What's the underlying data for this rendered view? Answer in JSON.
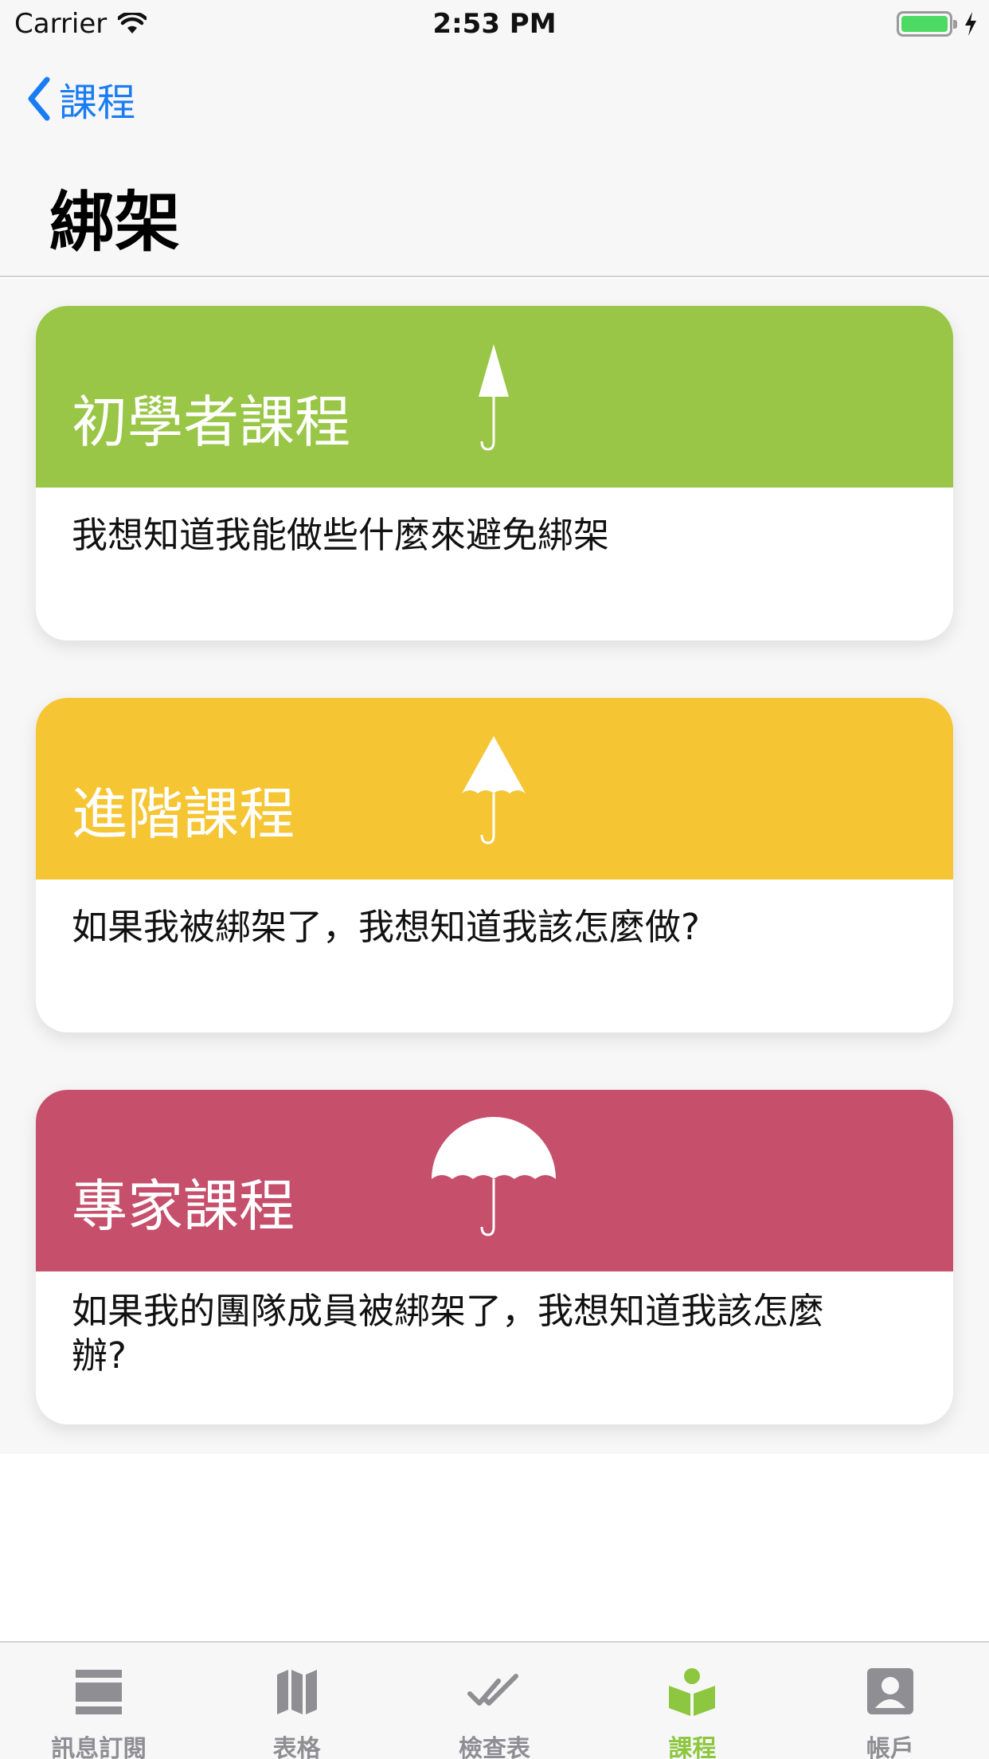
{
  "status_bar": {
    "carrier": "Carrier",
    "time": "2:53 PM"
  },
  "nav": {
    "back_label": "課程",
    "title": "綁架"
  },
  "colors": {
    "beginner": "#99c646",
    "advanced": "#f5c534",
    "expert": "#c64f6c",
    "tab_active": "#8dc63f",
    "tab_inactive": "#8e8e93",
    "link": "#1a7cf3"
  },
  "cards": [
    {
      "title": "初學者課程",
      "description": "我想知道我能做些什麼來避免綁架",
      "icon": "closed-umbrella-icon"
    },
    {
      "title": "進階課程",
      "description": "如果我被綁架了，我想知道我該怎麼做?",
      "icon": "half-open-umbrella-icon"
    },
    {
      "title": "專家課程",
      "description": "如果我的團隊成員被綁架了，我想知道我該怎麼辦?",
      "icon": "open-umbrella-icon"
    }
  ],
  "tabs": [
    {
      "label": "訊息訂閱",
      "icon": "feed-icon",
      "active": false
    },
    {
      "label": "表格",
      "icon": "map-icon",
      "active": false
    },
    {
      "label": "檢查表",
      "icon": "checklist-icon",
      "active": false
    },
    {
      "label": "課程",
      "icon": "course-icon",
      "active": true
    },
    {
      "label": "帳戶",
      "icon": "account-icon",
      "active": false
    }
  ]
}
